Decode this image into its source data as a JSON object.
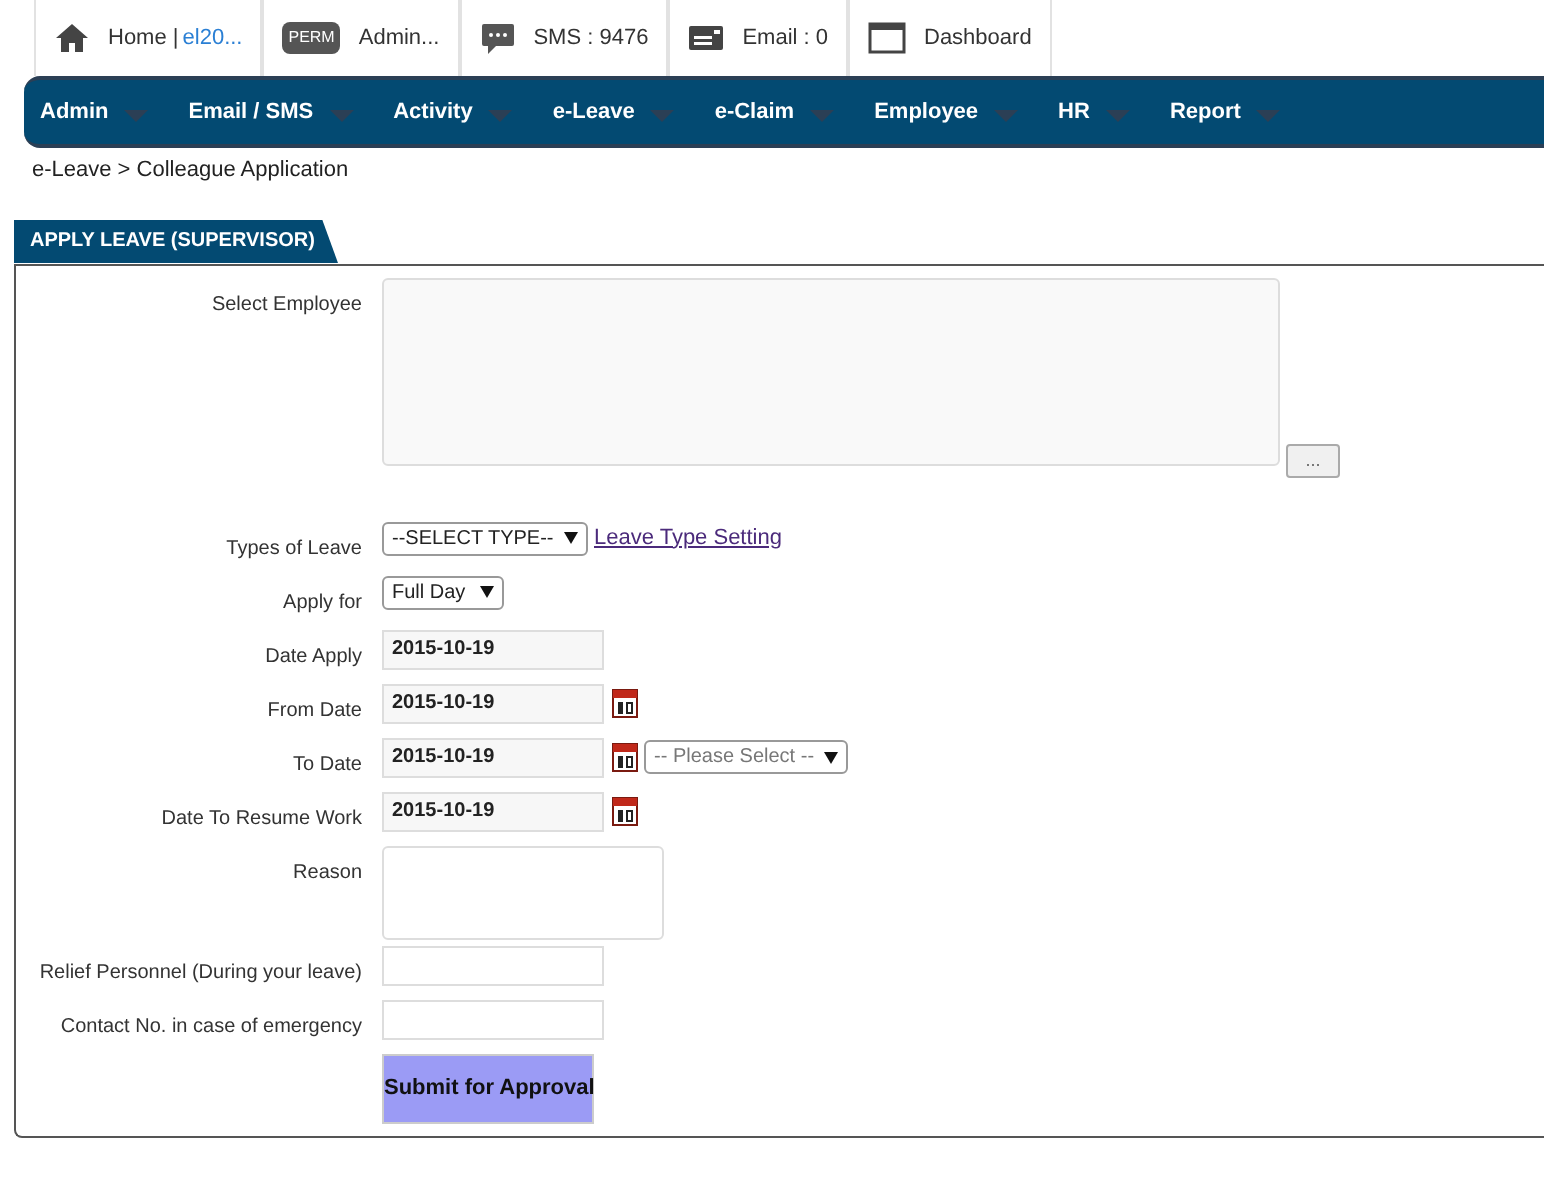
{
  "top_bar": [
    {
      "kind": "home",
      "label": "Home |",
      "link": "el20..."
    },
    {
      "kind": "perm",
      "badge": "PERM",
      "label": "Admin..."
    },
    {
      "kind": "sms",
      "label": "SMS : 9476"
    },
    {
      "kind": "email",
      "label": "Email : 0"
    },
    {
      "kind": "dashboard",
      "label": "Dashboard"
    }
  ],
  "nav": [
    "Admin",
    "Email / SMS",
    "Activity",
    "e-Leave",
    "e-Claim",
    "Employee",
    "HR",
    "Report"
  ],
  "breadcrumb": "e-Leave > Colleague Application",
  "panel": {
    "title": "APPLY LEAVE (SUPERVISOR)",
    "fields": [
      {
        "kind": "picker",
        "label": "Select Employee",
        "button": "..."
      },
      {
        "kind": "select_link",
        "label": "Types of Leave",
        "value": "--SELECT TYPE--",
        "link": "Leave Type Setting"
      },
      {
        "kind": "select",
        "label": "Apply for",
        "value": "Full Day"
      },
      {
        "kind": "date",
        "label": "Date Apply",
        "value": "2015-10-19",
        "calendar": false
      },
      {
        "kind": "date",
        "label": "From Date",
        "value": "2015-10-19",
        "calendar": true
      },
      {
        "kind": "date",
        "label": "To Date",
        "value": "2015-10-19",
        "calendar": true,
        "select": "-- Please Select --"
      },
      {
        "kind": "date",
        "label": "Date To Resume Work",
        "value": "2015-10-19",
        "calendar": true
      },
      {
        "kind": "textarea",
        "label": "Reason"
      },
      {
        "kind": "input",
        "label": "Relief Personnel (During your leave)"
      },
      {
        "kind": "input",
        "label": "Contact No. in case of emergency"
      },
      {
        "kind": "submit",
        "label": "Submit for Approval"
      }
    ]
  }
}
